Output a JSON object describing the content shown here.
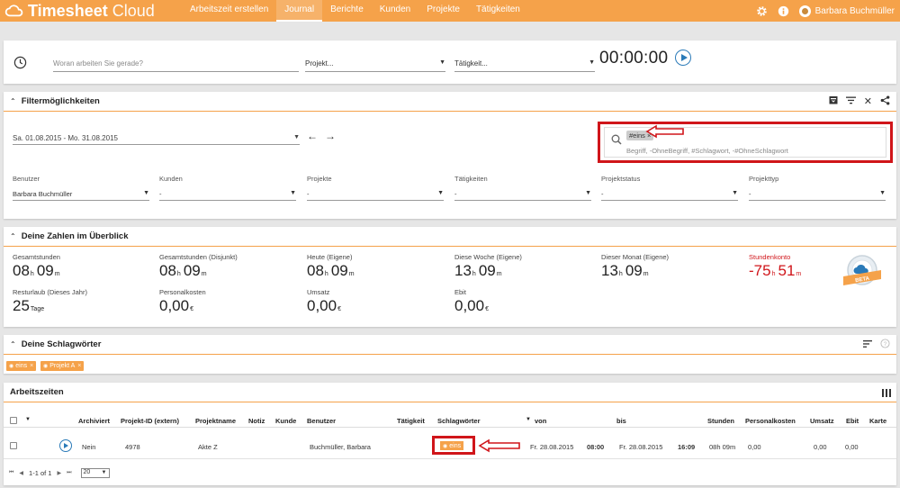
{
  "app": {
    "brand_bold": "Timesheet",
    "brand_light": "Cloud"
  },
  "nav": [
    "Arbeitszeit erstellen",
    "Journal",
    "Berichte",
    "Kunden",
    "Projekte",
    "Tätigkeiten"
  ],
  "nav_active": "Journal",
  "user": {
    "name": "Barbara Buchmüller"
  },
  "timer": {
    "task_placeholder": "Woran arbeiten Sie gerade?",
    "project_placeholder": "Projekt...",
    "activity_placeholder": "Tätigkeit...",
    "time": "00:00:00"
  },
  "filter": {
    "title": "Filtermöglichkeiten",
    "date_range": "Sa. 01.08.2015 - Mo. 31.08.2015",
    "search_chip": "#eins",
    "search_hint": "Begriff, -OhneBegriff, #Schlagwort, -#OhneSchlagwort",
    "fields": [
      {
        "label": "Benutzer",
        "value": "Barbara Buchmüller"
      },
      {
        "label": "Kunden",
        "value": "-"
      },
      {
        "label": "Projekte",
        "value": "-"
      },
      {
        "label": "Tätigkeiten",
        "value": "-"
      },
      {
        "label": "Projektstatus",
        "value": "-"
      },
      {
        "label": "Projekttyp",
        "value": "-"
      }
    ]
  },
  "overview": {
    "title": "Deine Zahlen im Überblick",
    "stats": [
      {
        "label": "Gesamtstunden",
        "h": "08",
        "m": "09"
      },
      {
        "label": "Gesamtstunden (Disjunkt)",
        "h": "08",
        "m": "09"
      },
      {
        "label": "Heute (Eigene)",
        "h": "08",
        "m": "09"
      },
      {
        "label": "Diese Woche (Eigene)",
        "h": "13",
        "m": "09"
      },
      {
        "label": "Dieser Monat (Eigene)",
        "h": "13",
        "m": "09"
      },
      {
        "label": "Stundenkonto",
        "h": "-75",
        "m": "51"
      }
    ],
    "stats2": [
      {
        "label": "Resturlaub (Dieses Jahr)",
        "value": "25",
        "unit": "Tage"
      },
      {
        "label": "Personalkosten",
        "value": "0,00",
        "unit": "€"
      },
      {
        "label": "Umsatz",
        "value": "0,00",
        "unit": "€"
      },
      {
        "label": "Ebit",
        "value": "0,00",
        "unit": "€"
      }
    ],
    "unit_h": "h",
    "unit_m": "m",
    "badge_text": "BETA"
  },
  "tags": {
    "title": "Deine Schlagwörter",
    "items": [
      "eins",
      "Projekt A"
    ]
  },
  "works": {
    "title": "Arbeitszeiten",
    "columns": [
      "Archiviert",
      "Projekt-ID (extern)",
      "Projektname",
      "Notiz",
      "Kunde",
      "Benutzer",
      "Tätigkeit",
      "Schlagwörter",
      "von",
      "bis",
      "Stunden",
      "Personalkosten",
      "Umsatz",
      "Ebit",
      "Karte"
    ],
    "row": {
      "archiviert": "Nein",
      "projekt_id": "4978",
      "projektname": "Akte Z",
      "benutzer": "Buchmüller, Barbara",
      "tag": "eins",
      "von_date": "Fr. 28.08.2015",
      "von_time": "08:00",
      "bis_date": "Fr. 28.08.2015",
      "bis_time": "16:09",
      "stunden": "08h 09m",
      "personalkosten": "0,00",
      "umsatz": "0,00",
      "ebit": "0,00"
    },
    "pager": {
      "range": "1-1 of 1",
      "page_size": "20"
    }
  },
  "colors": {
    "accent": "#f5a24a",
    "highlight": "#d0151a",
    "link": "#2a7ab8"
  }
}
